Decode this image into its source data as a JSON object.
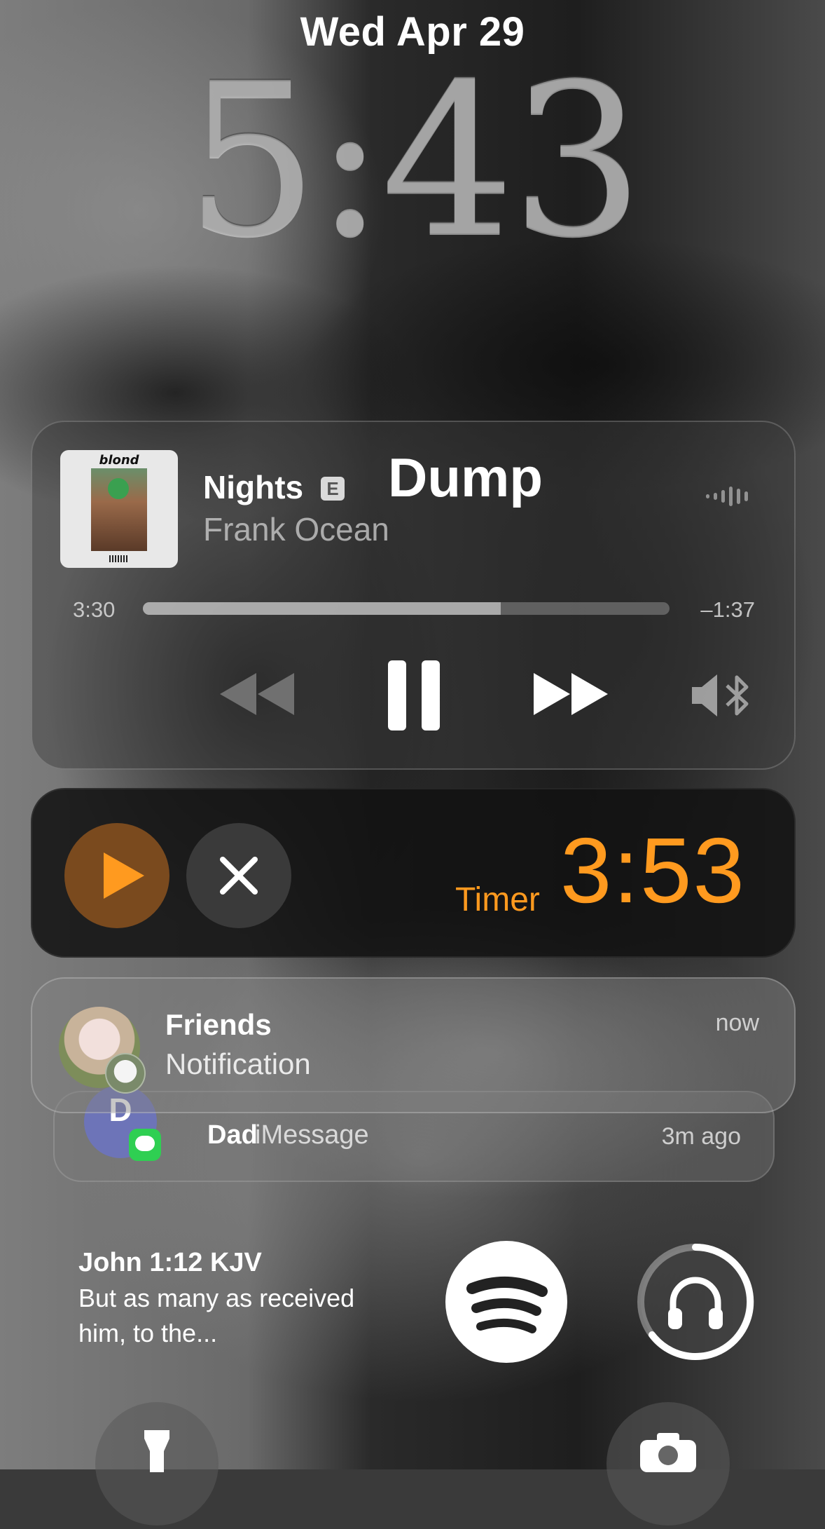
{
  "lock_screen": {
    "date": "Wed Apr 29",
    "time": "5:43"
  },
  "now_playing": {
    "album_title": "blond",
    "song": "Nights",
    "explicit_badge": "E",
    "widget_label": "Dump",
    "artist": "Frank Ocean",
    "elapsed": "3:30",
    "remaining": "–1:37",
    "progress_fraction": 0.68,
    "controls": [
      "rewind-icon",
      "pause-icon",
      "fast-forward-icon",
      "speaker-bluetooth-icon"
    ]
  },
  "timer": {
    "label": "Timer",
    "value": "3:53",
    "accent_color": "#ff9a1f",
    "controls": [
      "play-icon",
      "close-icon"
    ]
  },
  "notifications": [
    {
      "title": "Friends",
      "body": "Notification",
      "time": "now"
    },
    {
      "avatar_letter": "D",
      "title": "Dad",
      "app": "iMessage",
      "time": "3m ago"
    }
  ],
  "verse_widget": {
    "reference": "John 1:12 KJV",
    "text": "But as many as received him, to the..."
  },
  "widgets": [
    "spotify-icon",
    "headphones-icon"
  ],
  "quick_actions": [
    "flashlight-icon",
    "camera-icon"
  ]
}
